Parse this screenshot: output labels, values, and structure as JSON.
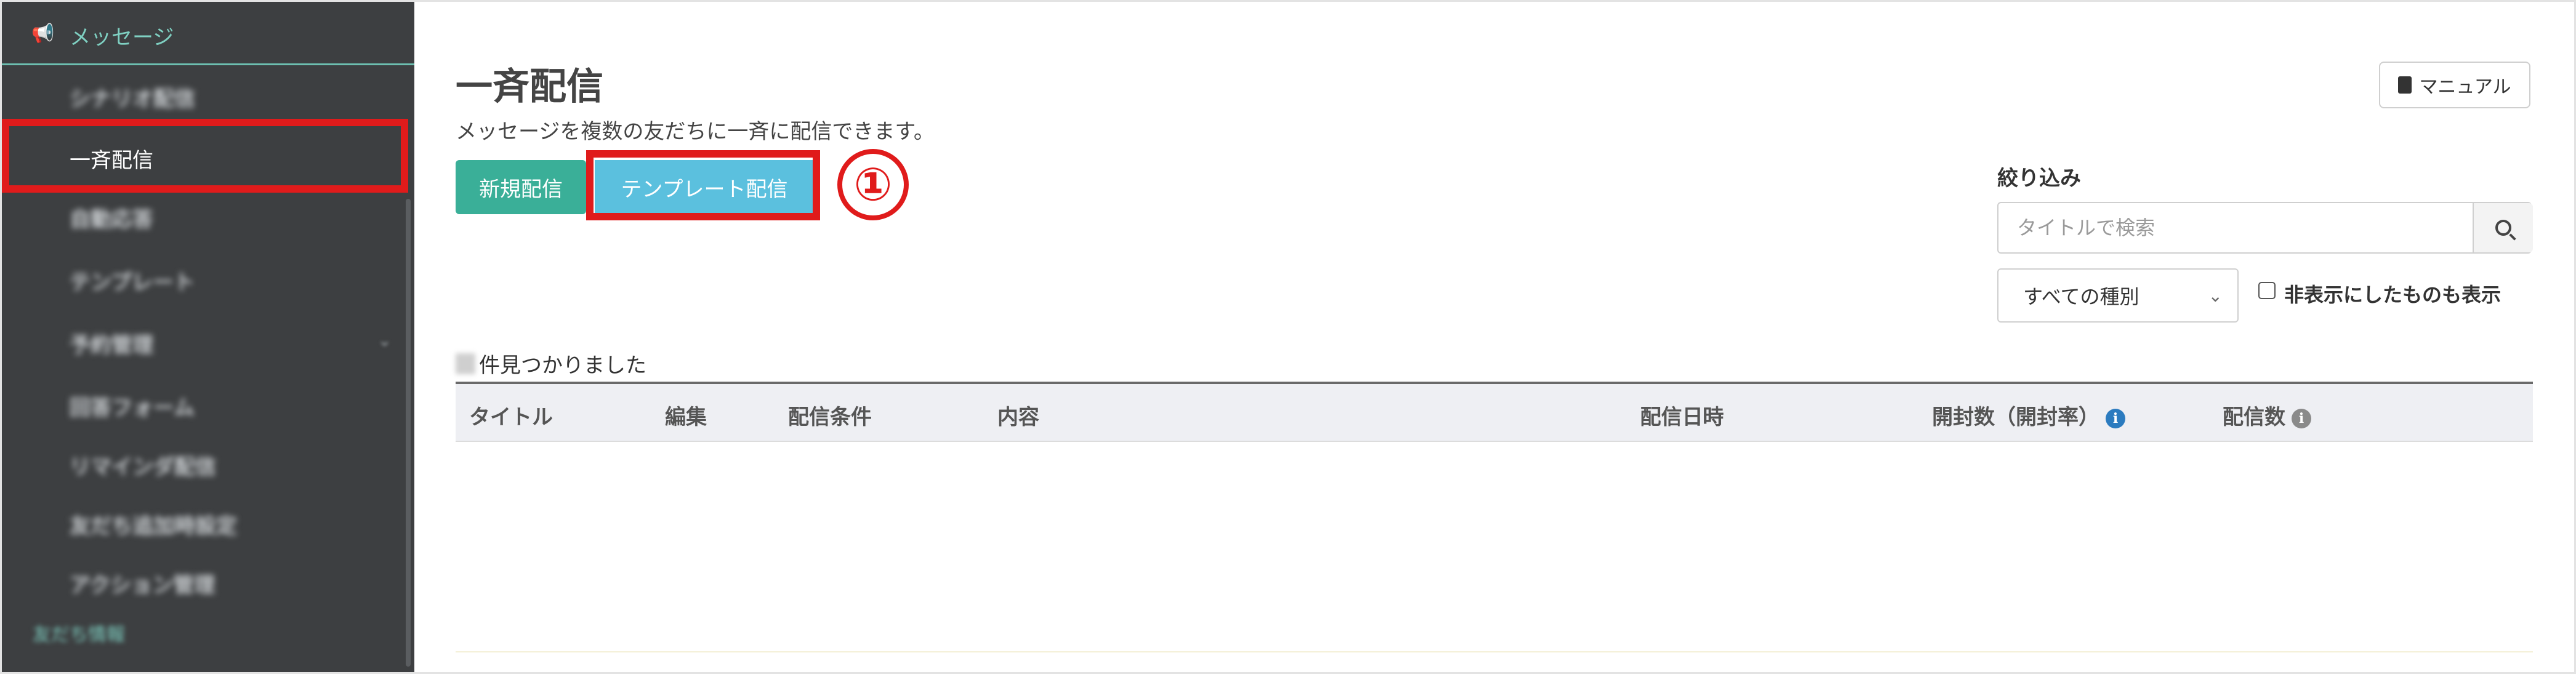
{
  "sidebar": {
    "section_label": "メッセージ",
    "items": [
      {
        "label": "シナリオ配信"
      },
      {
        "label": "一斉配信"
      },
      {
        "label": "自動応答"
      },
      {
        "label": "テンプレート"
      },
      {
        "label": "予約管理"
      },
      {
        "label": "回答フォーム"
      },
      {
        "label": "リマインダ配信"
      },
      {
        "label": "友だち追加時設定"
      },
      {
        "label": "アクション管理"
      }
    ],
    "bottom_label": "友だち情報"
  },
  "header": {
    "title": "一斉配信",
    "description": "メッセージを複数の友だちに一斉に配信できます。",
    "manual_label": "マニュアル"
  },
  "actions": {
    "new_label": "新規配信",
    "template_label": "テンプレート配信",
    "annotation_number": "①"
  },
  "filter": {
    "label": "絞り込み",
    "search_placeholder": "タイトルで検索",
    "type_select_value": "すべての種別",
    "hide_label": "非表示にしたものも表示"
  },
  "results": {
    "count_suffix": "件見つかりました"
  },
  "table": {
    "columns": [
      "タイトル",
      "編集",
      "配信条件",
      "内容",
      "配信日時",
      "開封数（開封率）",
      "配信数"
    ]
  },
  "colors": {
    "sidebar_bg": "#3d3f41",
    "accent_teal": "#3aaf98",
    "template_blue": "#5bc0de",
    "highlight_red": "#e01b1b"
  }
}
